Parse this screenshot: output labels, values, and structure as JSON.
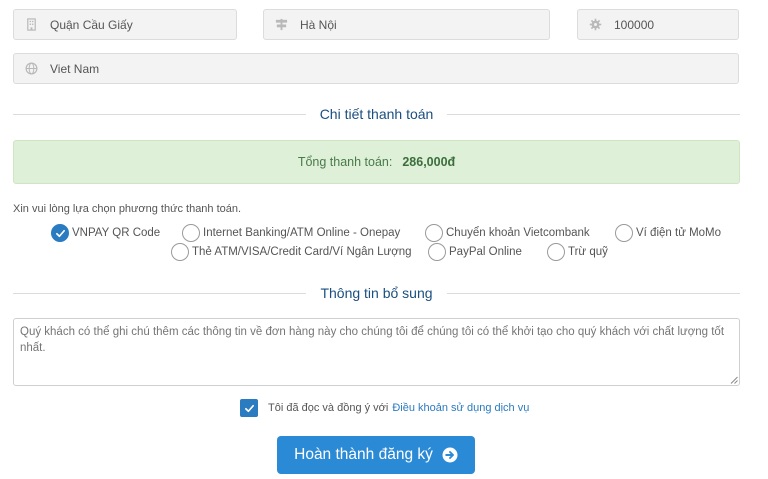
{
  "address": {
    "district": "Quận Cầu Giấy",
    "city": "Hà Nội",
    "postal_code": "100000",
    "country": "Viet Nam"
  },
  "payment_details": {
    "title": "Chi tiết thanh toán",
    "total_label": "Tổng thanh toán:",
    "total_value": "286,000đ"
  },
  "payment_methods": {
    "hint": "Xin vui lòng lựa chọn phương thức thanh toán.",
    "options": [
      {
        "label": "VNPAY QR Code",
        "selected": true
      },
      {
        "label": "Internet Banking/ATM Online - Onepay",
        "selected": false
      },
      {
        "label": "Chuyển khoản Vietcombank",
        "selected": false
      },
      {
        "label": "Ví điện tử MoMo",
        "selected": false
      },
      {
        "label": "Thẻ ATM/VISA/Credit Card/Ví Ngân Lượng",
        "selected": false
      },
      {
        "label": "PayPal Online",
        "selected": false
      },
      {
        "label": "Trừ quỹ",
        "selected": false
      }
    ]
  },
  "additional_info": {
    "title": "Thông tin bổ sung",
    "notes_placeholder": "Quý khách có thể ghi chú thêm các thông tin về đơn hàng này cho chúng tôi để chúng tôi có thể khởi tạo cho quý khách với chất lượng tốt nhất."
  },
  "agreement": {
    "checked": true,
    "text": "Tôi đã đọc và đồng ý với",
    "link": "Điều khoản sử dụng dịch vụ"
  },
  "submit": {
    "label": "Hoàn thành đăng ký"
  },
  "colors": {
    "accent": "#2a8ad6",
    "section_title": "#1b4f80",
    "total_bg": "#dff0d8"
  }
}
